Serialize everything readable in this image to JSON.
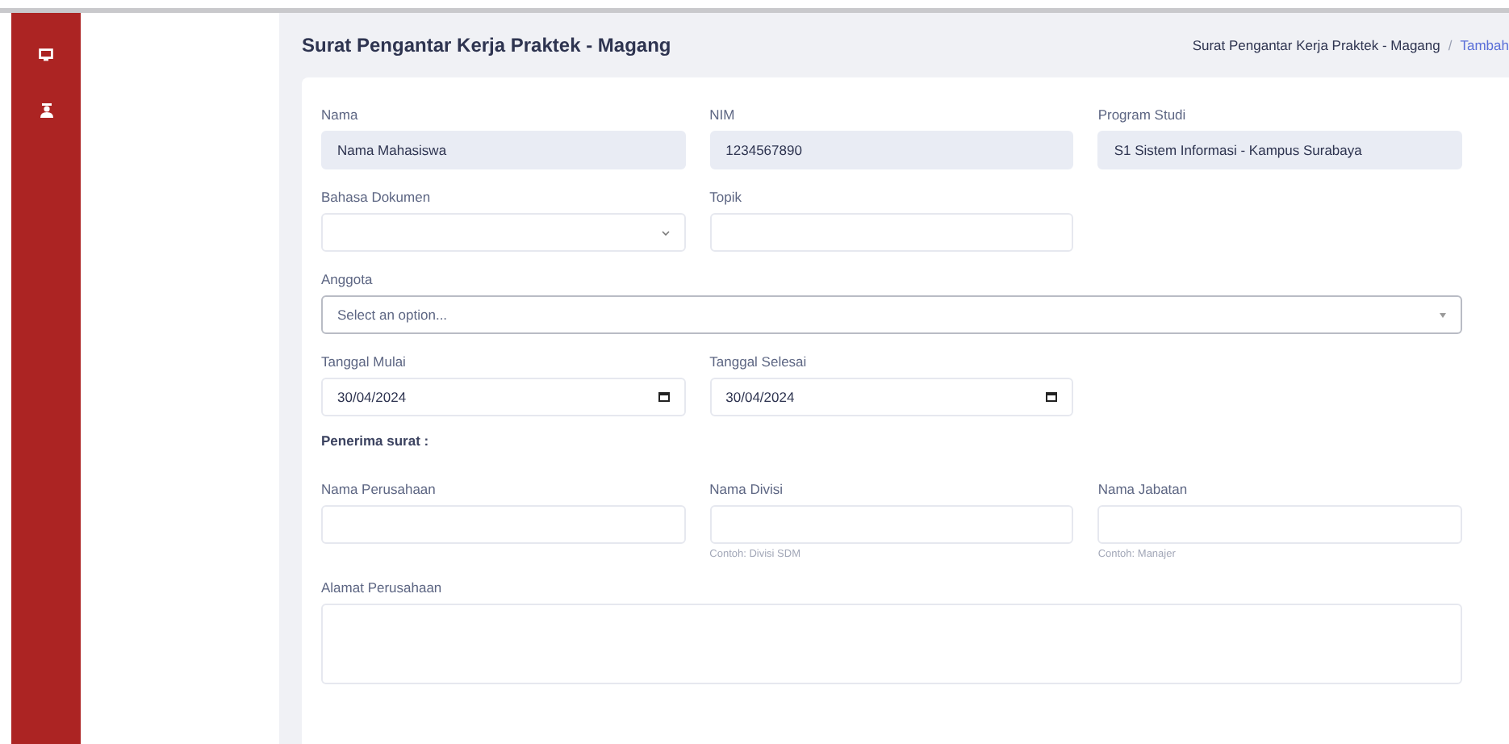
{
  "sidebar": {
    "items": [
      {
        "kind": "monitor"
      },
      {
        "kind": "person"
      }
    ]
  },
  "header": {
    "title": "Surat Pengantar Kerja Praktek - Magang",
    "breadcrumb": [
      {
        "label": "Surat Pengantar Kerja Praktek - Magang",
        "selected": false
      },
      {
        "label": "Tambah",
        "selected": true
      }
    ],
    "separator": "/"
  },
  "rows": [
    {
      "kind": "fields",
      "fields": [
        {
          "label": "Nama",
          "kind": "readonly",
          "value": "Nama Mahasiswa"
        },
        {
          "label": "NIM",
          "kind": "readonly",
          "value": "1234567890"
        },
        {
          "label": "Program Studi",
          "kind": "readonly",
          "value": "S1 Sistem Informasi - Kampus Surabaya"
        }
      ]
    },
    {
      "kind": "fields",
      "fields": [
        {
          "label": "Bahasa Dokumen",
          "kind": "select"
        },
        {
          "label": "Topik",
          "kind": "text"
        }
      ]
    },
    {
      "kind": "fields",
      "fields": [
        {
          "label": "Anggota",
          "kind": "combo",
          "placeholder": "Select an option..."
        }
      ]
    },
    {
      "kind": "fields",
      "fields": [
        {
          "label": "Tanggal Mulai",
          "kind": "date",
          "value": "30/04/2024"
        },
        {
          "label": "Tanggal Selesai",
          "kind": "date",
          "value": "30/04/2024"
        }
      ]
    },
    {
      "kind": "heading",
      "text": "Penerima surat :"
    },
    {
      "kind": "fields",
      "fields": [
        {
          "label": "Nama Perusahaan",
          "kind": "text"
        },
        {
          "label": "Nama Divisi",
          "kind": "text",
          "hint": "Contoh: Divisi SDM"
        },
        {
          "label": "Nama Jabatan",
          "kind": "text",
          "hint": "Contoh: Manajer"
        }
      ]
    },
    {
      "kind": "fields",
      "fields": [
        {
          "label": "Alamat Perusahaan",
          "kind": "textarea"
        }
      ]
    }
  ]
}
